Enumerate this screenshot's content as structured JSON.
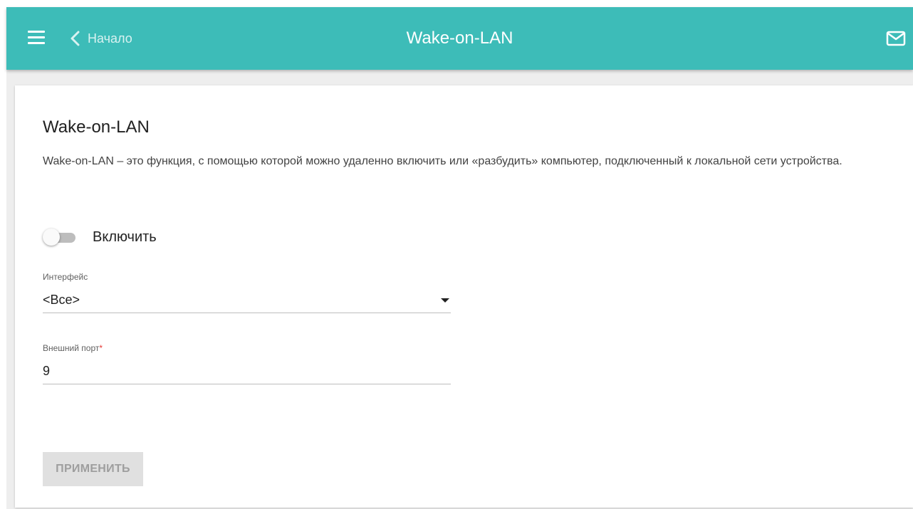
{
  "topbar": {
    "back_label": "Начало",
    "title": "Wake-on-LAN",
    "icons": {
      "menu": "hamburger-menu-icon",
      "back": "chevron-left-icon",
      "mail": "mail-icon"
    },
    "colors": {
      "bar": "#3dbcb8",
      "text": "#ffffff"
    }
  },
  "card": {
    "title": "Wake-on-LAN",
    "description": "Wake-on-LAN – это функция, с помощью которой можно удаленно включить или «разбудить» компьютер, подключенный к локальной сети устройства.",
    "enable": {
      "label": "Включить",
      "checked": false
    },
    "interface": {
      "label": "Интерфейс",
      "value": "<Все>"
    },
    "external_port": {
      "label": "Внешний порт",
      "required_mark": "*",
      "value": "9"
    },
    "apply_label": "ПРИМЕНИТЬ"
  }
}
